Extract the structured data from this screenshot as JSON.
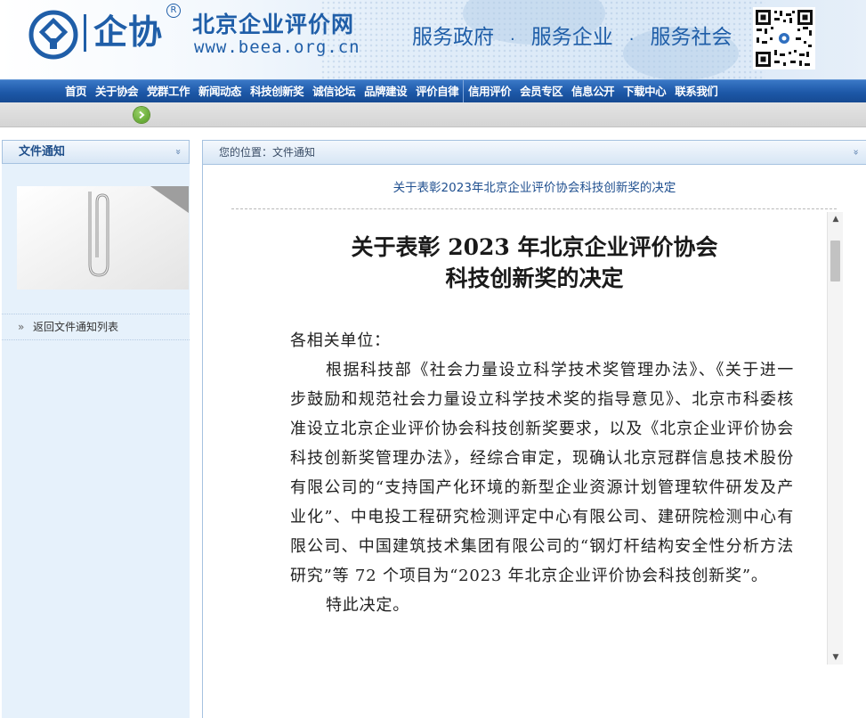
{
  "header": {
    "logo_text": "企协",
    "logo_reg": "R",
    "site_name": "北京企业评价网",
    "site_url": "www.beea.org.cn",
    "slogans": [
      "服务政府",
      "服务企业",
      "服务社会"
    ],
    "slogan_sep": "."
  },
  "nav": {
    "items": [
      "首页",
      "关于协会",
      "党群工作",
      "新闻动态",
      "科技创新奖",
      "诚信论坛",
      "品牌建设",
      "评价自律",
      "信用评价",
      "会员专区",
      "信息公开",
      "下载中心",
      "联系我们"
    ]
  },
  "sidebar": {
    "title": "文件通知",
    "collapse_glyph": "»",
    "back_arrow": "»",
    "back_link": "返回文件通知列表"
  },
  "main": {
    "breadcrumb": "您的位置：文件通知",
    "collapse_glyph": "»",
    "article_title": "关于表彰2023年北京企业评价协会科技创新奖的决定"
  },
  "document": {
    "title_line1": "关于表彰 2023 年北京企业评价协会",
    "title_line2": "科技创新奖的决定",
    "salutation": "各相关单位：",
    "paragraph1": "根据科技部《社会力量设立科学技术奖管理办法》、《关于进一步鼓励和规范社会力量设立科学技术奖的指导意见》、北京市科委核准设立北京企业评价协会科技创新奖要求，以及《北京企业评价协会科技创新奖管理办法》，经综合审定，现确认北京冠群信息技术股份有限公司的“支持国产化环境的新型企业资源计划管理软件研发及产业化”、中电投工程研究检测评定中心有限公司、建研院检测中心有限公司、中国建筑技术集团有限公司的“钢灯杆结构安全性分析方法研究”等 72 个项目为“2023 年北京企业评价协会科技创新奖”。",
    "paragraph2": "特此决定。"
  },
  "scrollbar": {
    "up_glyph": "▲",
    "down_glyph": "▼"
  },
  "colors": {
    "brand_blue": "#1f5ea8",
    "nav_blue": "#1d58a8",
    "sidebar_bg": "#e6f1fb",
    "link_title": "#1f4f8f",
    "go_green": "#4f9a1e"
  },
  "icons": {
    "logo": "beea-logo-icon",
    "qr": "qr-code-icon",
    "go": "go-arrow-icon",
    "paperclip": "paperclip-image"
  }
}
